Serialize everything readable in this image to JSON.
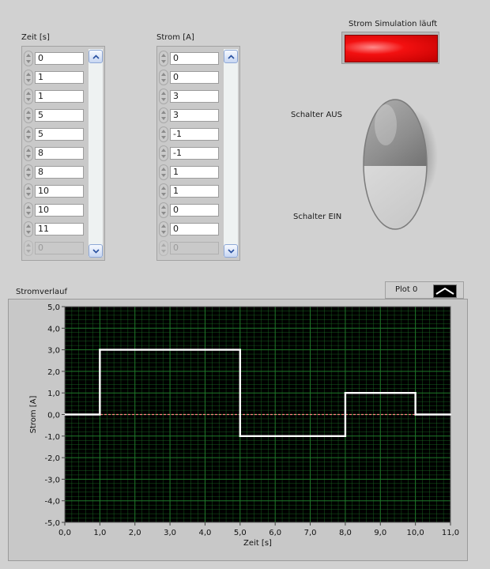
{
  "zeit_array": {
    "label": "Zeit [s]",
    "values": [
      "0",
      "1",
      "1",
      "5",
      "5",
      "8",
      "8",
      "10",
      "10",
      "11"
    ],
    "empty_value": "0"
  },
  "strom_array": {
    "label": "Strom [A]",
    "values": [
      "0",
      "0",
      "3",
      "3",
      "-1",
      "-1",
      "1",
      "1",
      "0",
      "0"
    ],
    "empty_value": "0"
  },
  "led": {
    "label": "Strom Simulation läuft",
    "state": "on",
    "color": "#f31010"
  },
  "switch": {
    "label_off": "Schalter AUS",
    "label_on": "Schalter EIN"
  },
  "graph": {
    "label": "Stromverlauf",
    "legend_name": "Plot 0"
  },
  "chart_data": {
    "type": "line",
    "title": "Stromverlauf",
    "xlabel": "Zeit [s]",
    "ylabel": "Strom [A]",
    "xlim": [
      0,
      11
    ],
    "ylim": [
      -5,
      5
    ],
    "x_ticks": [
      "0,0",
      "1,0",
      "2,0",
      "3,0",
      "4,0",
      "5,0",
      "6,0",
      "7,0",
      "8,0",
      "9,0",
      "10,0",
      "11,0"
    ],
    "y_ticks": [
      "5,0",
      "4,0",
      "3,0",
      "2,0",
      "1,0",
      "0,0",
      "-1,0",
      "-2,0",
      "-3,0",
      "-4,0",
      "-5,0"
    ],
    "grid": true,
    "background": "#000000",
    "grid_color": "#1f7a2a",
    "series": [
      {
        "name": "Plot 0",
        "color": "#ffffff",
        "x": [
          0,
          1,
          1,
          5,
          5,
          8,
          8,
          10,
          10,
          11
        ],
        "y": [
          0,
          0,
          3,
          3,
          -1,
          -1,
          1,
          1,
          0,
          0
        ]
      }
    ],
    "zero_line_color": "#ff8080"
  }
}
